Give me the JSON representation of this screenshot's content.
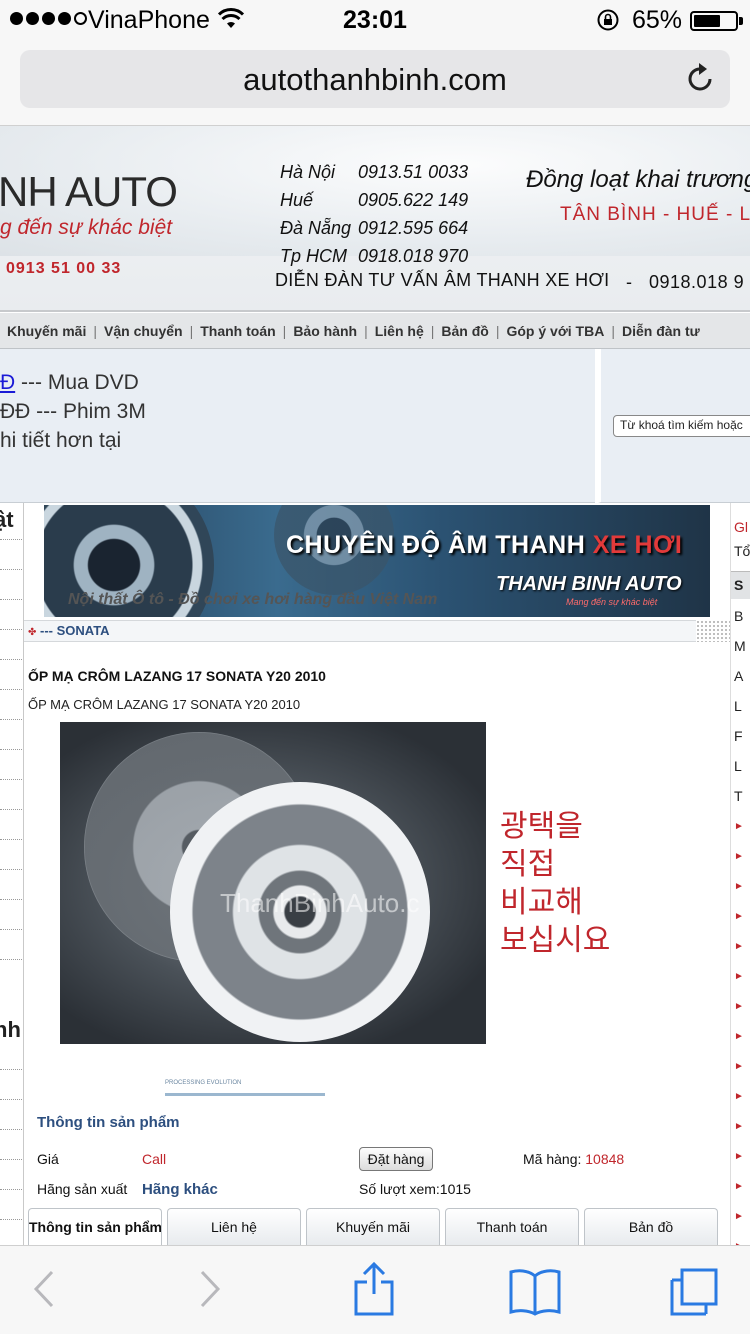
{
  "status_bar": {
    "carrier": "VinaPhone",
    "time": "23:01",
    "battery_percent": "65%",
    "battery_level": 0.65
  },
  "browser": {
    "url": "autothanhbinh.com"
  },
  "banner": {
    "logo_text": "NH AUTO",
    "logo_slogan": "g đến sự khác biệt",
    "logo_phone": "0913 51 00 33",
    "contacts": [
      {
        "city": "Hà Nội",
        "number": "0913.51 0033"
      },
      {
        "city": "Huế",
        "number": "0905.622 149"
      },
      {
        "city": "Đà Nẵng",
        "number": "0912.595 664"
      },
      {
        "city": "Tp HCM",
        "number": "0918.018 970"
      }
    ],
    "slogan_right": "Đồng loạt khai trương",
    "cities_right": "TÂN BÌNH - HUẾ - L",
    "forum_line": "DIỄN ĐÀN TƯ VẤN ÂM THANH XE HƠI",
    "forum_dash": "-",
    "forum_phone": "0918.018 9"
  },
  "nav": {
    "items": [
      "Khuyến mãi",
      "Vận chuyển",
      "Thanh toán",
      "Bảo hành",
      "Liên hệ",
      "Bản đồ",
      "Góp ý với TBA",
      "Diễn đàn tư"
    ]
  },
  "promo": {
    "line1_link": "Đ",
    "line1_text": " --- Mua DVD",
    "line2": "ĐĐ --- Phim 3M",
    "line3": "hi tiết hơn tại",
    "search_placeholder": "Từ khoá tìm kiếm hoặc"
  },
  "left_sidebar": {
    "heading1": "ật",
    "heading2": "nh"
  },
  "right_sidebar": {
    "top_red": "Gl",
    "top_text": "Tổ",
    "head_label": "S",
    "items": [
      "B",
      "M",
      "A",
      "L",
      "F",
      "L",
      "T"
    ]
  },
  "main_banner": {
    "title_white": "CHUYÊN ĐỘ ÂM THANH ",
    "title_red": "XE HƠI",
    "brand": "THANH BINH AUTO",
    "brand_sub": "Mang đến sự khác biệt",
    "tagline": "Nội thất Ô tô - Đồ chơi xe hơi hàng đầu Việt Nam"
  },
  "breadcrumb": {
    "text": "--- SONATA"
  },
  "product": {
    "title": "ỐP MẠ CRÔM LAZANG 17 SONATA Y20 2010",
    "subtitle": "ỐP MẠ CRÔM LAZANG 17 SONATA Y20 2010",
    "watermark": "ThanhBinhAuto.c",
    "korean_text": "광택을\n직접\n비교해\n보십시요",
    "strip_text": "PROCESSING EVOLUTION"
  },
  "info": {
    "heading": "Thông tin sản phẩm",
    "price_label": "Giá",
    "price_value": "Call",
    "order_button": "Đặt hàng",
    "code_label": "Mã hàng:",
    "code_value": "10848",
    "maker_label": "Hãng sản xuất",
    "maker_value": "Hãng khác",
    "views_label": "Số lượt xem:1015"
  },
  "tabs": [
    "Thông tin sản phẩm",
    "Liên hệ",
    "Khuyến mãi",
    "Thanh toán",
    "Bản đồ"
  ],
  "toolbar": {
    "icons": [
      "back-icon",
      "forward-icon",
      "share-icon",
      "bookmarks-icon",
      "tabs-icon"
    ]
  }
}
